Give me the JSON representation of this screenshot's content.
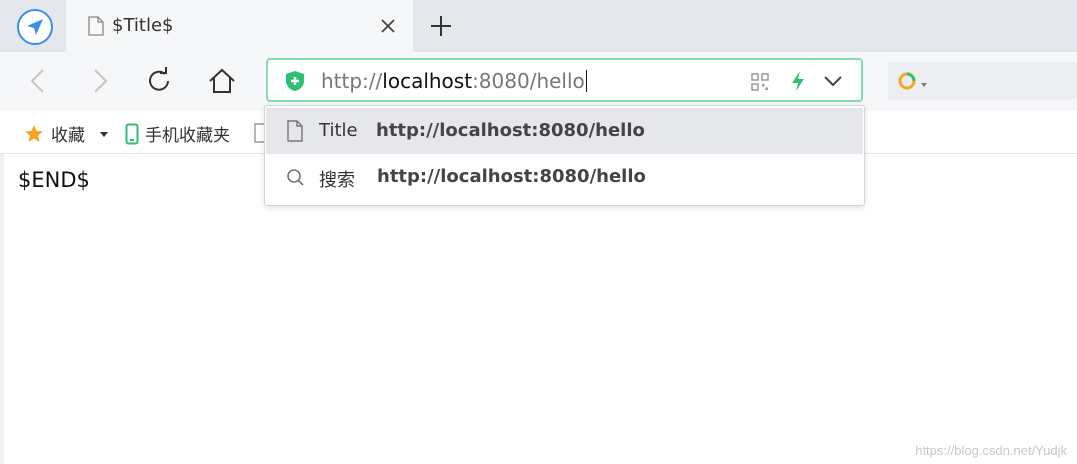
{
  "tab": {
    "title": "$Title$"
  },
  "address_bar": {
    "url_prefix": "http://",
    "url_host": "localhost",
    "url_rest": ":8080/hello"
  },
  "bookmarks": {
    "favorites_label": "收藏",
    "mobile_label": "手机收藏夹"
  },
  "page": {
    "body_text": "$END$"
  },
  "suggestions": [
    {
      "kind_label": "Title",
      "url": "http://localhost:8080/hello",
      "icon": "document-icon"
    },
    {
      "kind_label": "搜索",
      "url": "http://localhost:8080/hello",
      "icon": "search-icon"
    }
  ],
  "watermark": "https://blog.csdn.net/Yudjk",
  "colors": {
    "accent_green": "#7fdcae",
    "shield_green": "#2fbf71",
    "logo_blue": "#3b8fe6",
    "star_orange": "#f5a623"
  }
}
